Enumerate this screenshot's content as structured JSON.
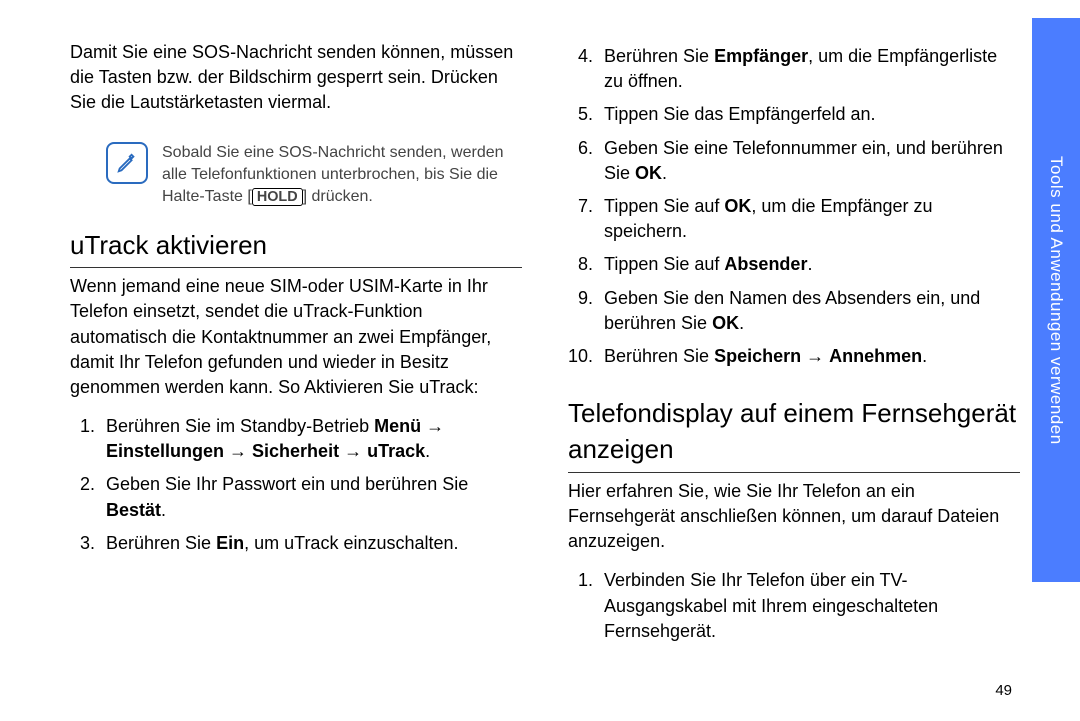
{
  "sidebar": {
    "label": "Tools und Anwendungen verwenden"
  },
  "pagenum": "49",
  "left": {
    "intro": "Damit Sie eine SOS-Nachricht senden können, müssen die Tasten bzw. der Bildschirm gesperrt sein. Drücken Sie die Lautstärketasten viermal.",
    "note": {
      "pre": "Sobald Sie eine SOS-Nachricht senden, werden alle Telefonfunktionen unterbrochen, bis Sie die Halte-Taste [",
      "key": "HOLD",
      "post": "] drücken."
    },
    "h2": "uTrack aktivieren",
    "desc": "Wenn jemand eine neue SIM-oder USIM-Karte in Ihr Telefon einsetzt, sendet die uTrack-Funktion automatisch die Kontaktnummer an zwei Empfänger, damit Ihr Telefon gefunden und wieder in Besitz genommen werden kann. So Aktivieren Sie uTrack:",
    "steps": {
      "s1_a": "Berühren Sie im Standby-Betrieb ",
      "s1_b": "Menü",
      "s1_c": " → ",
      "s1_d": "Einstellungen",
      "s1_e": " → ",
      "s1_f": "Sicherheit",
      "s1_g": " → ",
      "s1_h": "uTrack",
      "s1_i": ".",
      "s2_a": "Geben Sie Ihr Passwort ein und berühren Sie ",
      "s2_b": "Bestät",
      "s2_c": ".",
      "s3_a": "Berühren Sie ",
      "s3_b": "Ein",
      "s3_c": ", um uTrack einzuschalten."
    }
  },
  "right": {
    "steps": {
      "s4_a": "Berühren Sie ",
      "s4_b": "Empfänger",
      "s4_c": ", um die Empfängerliste zu öffnen.",
      "s5": "Tippen Sie das Empfängerfeld an.",
      "s6_a": "Geben Sie eine Telefonnummer ein, und berühren Sie ",
      "s6_b": "OK",
      "s6_c": ".",
      "s7_a": "Tippen Sie auf ",
      "s7_b": "OK",
      "s7_c": ", um die Empfänger zu speichern.",
      "s8_a": "Tippen Sie auf ",
      "s8_b": "Absender",
      "s8_c": ".",
      "s9_a": "Geben Sie den Namen des Absenders ein, und berühren Sie ",
      "s9_b": "OK",
      "s9_c": ".",
      "s10_a": "Berühren Sie ",
      "s10_b": "Speichern",
      "s10_c": " → ",
      "s10_d": "Annehmen",
      "s10_e": "."
    },
    "h2": "Telefondisplay auf einem Fernsehgerät anzeigen",
    "desc": "Hier erfahren Sie, wie Sie Ihr Telefon an ein Fernsehgerät anschließen können, um darauf Dateien anzuzeigen.",
    "steps2": {
      "s1": "Verbinden Sie Ihr Telefon über ein TV-Ausgangskabel mit Ihrem eingeschalteten Fernsehgerät."
    }
  }
}
